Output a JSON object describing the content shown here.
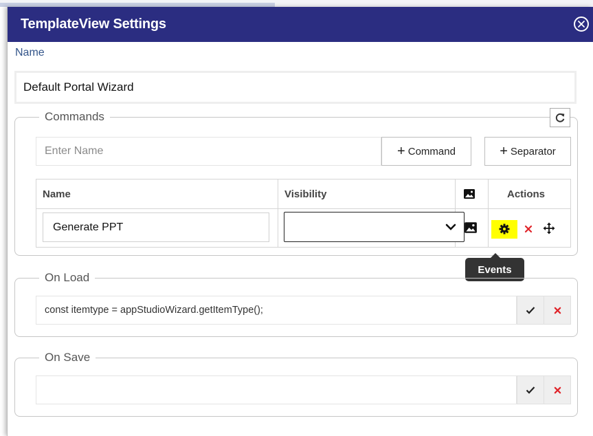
{
  "dialog": {
    "title": "TemplateView Settings",
    "close_icon": "circle-x-icon"
  },
  "name_field": {
    "label": "Name",
    "value": "Default Portal Wizard"
  },
  "commands": {
    "legend": "Commands",
    "refresh_icon": "refresh-icon",
    "input_placeholder": "Enter Name",
    "add_command_label": "Command",
    "add_separator_label": "Separator",
    "table": {
      "headers": {
        "name": "Name",
        "visibility": "Visibility",
        "image_icon": "image-icon",
        "actions": "Actions"
      },
      "rows": [
        {
          "name": "Generate PPT",
          "visibility": "",
          "icons": [
            "image-icon",
            "gear-icon",
            "delete-x-icon",
            "move-icon"
          ]
        }
      ]
    },
    "tooltip": "Events",
    "colors": {
      "highlight": "#ffff00",
      "delete": "#e0242a"
    }
  },
  "on_load": {
    "legend": "On Load",
    "value": "const itemtype = appStudioWizard.getItemType();"
  },
  "on_save": {
    "legend": "On Save",
    "value": ""
  },
  "theme": {
    "titlebar": "#2b2d81",
    "label": "#33558a"
  }
}
